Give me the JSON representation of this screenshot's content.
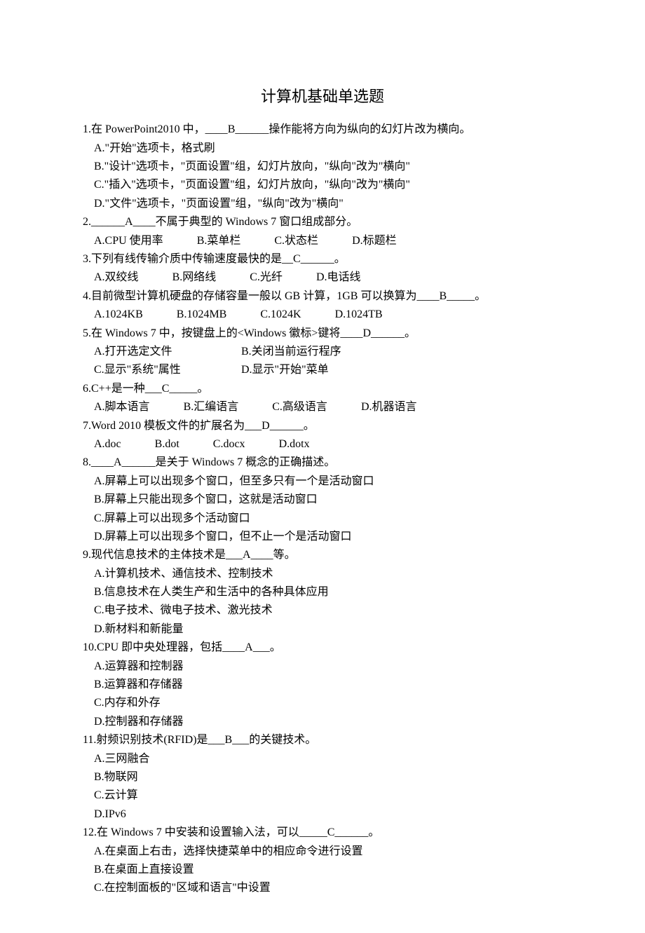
{
  "title": "计算机基础单选题",
  "questions": [
    {
      "num": "1",
      "stem_pre": "在 PowerPoint2010 中，____",
      "answer": "B",
      "stem_post": "______操作能将方向为纵向的幻灯片改为横向。",
      "options_layout": "block",
      "options": [
        "A.\"开始\"选项卡，格式刷",
        "B.\"设计\"选项卡，\"页面设置\"组，幻灯片放向，\"纵向\"改为\"横向\"",
        "C.\"插入\"选项卡，\"页面设置\"组，幻灯片放向，\"纵向\"改为\"横向\"",
        "D.\"文件\"选项卡，\"页面设置\"组，\"纵向\"改为\"横向\""
      ]
    },
    {
      "num": "2",
      "stem_pre": "______",
      "answer": "A",
      "stem_post": "____不属于典型的 Windows 7 窗口组成部分。",
      "options_layout": "inline",
      "options": [
        "A.CPU 使用率",
        "B.菜单栏",
        "C.状态栏",
        "D.标题栏"
      ]
    },
    {
      "num": "3",
      "stem_pre": "下列有线传输介质中传输速度最快的是__",
      "answer": "C",
      "stem_post": "______。",
      "options_layout": "inline",
      "options": [
        "A.双绞线",
        "B.网络线",
        "C.光纤",
        "D.电话线"
      ]
    },
    {
      "num": "4",
      "stem_pre": "目前微型计算机硬盘的存储容量一般以 GB 计算，1GB 可以换算为____",
      "answer": "B",
      "stem_post": "_____。",
      "options_layout": "inline",
      "options": [
        "A.1024KB",
        "B.1024MB",
        "C.1024K",
        "D.1024TB"
      ]
    },
    {
      "num": "5",
      "stem_pre": "在 Windows 7 中，按键盘上的<Windows 徽标>键将____",
      "answer": "D",
      "stem_post": "______。",
      "options_layout": "two-col",
      "options": [
        "A.打开选定文件",
        "B.关闭当前运行程序",
        "C.显示\"系统\"属性",
        "D.显示\"开始\"菜单"
      ]
    },
    {
      "num": "6",
      "stem_pre": "C++是一种___",
      "answer": "C",
      "stem_post": "_____。",
      "options_layout": "inline",
      "options": [
        "A.脚本语言",
        "B.汇编语言",
        "C.高级语言",
        "D.机器语言"
      ]
    },
    {
      "num": "7",
      "stem_pre": "Word 2010 模板文件的扩展名为___",
      "answer": "D",
      "stem_post": "______。",
      "options_layout": "inline",
      "options": [
        "A.doc",
        "B.dot",
        "C.docx",
        "D.dotx"
      ]
    },
    {
      "num": "8",
      "stem_pre": "____",
      "answer": "A",
      "stem_post": "______是关于 Windows 7 概念的正确描述。",
      "options_layout": "block",
      "options": [
        "A.屏幕上可以出现多个窗口，但至多只有一个是活动窗口",
        "B.屏幕上只能出现多个窗口，这就是活动窗口",
        "C.屏幕上可以出现多个活动窗口",
        "D.屏幕上可以出现多个窗口，但不止一个是活动窗口"
      ]
    },
    {
      "num": "9",
      "stem_pre": "现代信息技术的主体技术是___",
      "answer": "A",
      "stem_post": "____等。",
      "options_layout": "block",
      "options": [
        "A.计算机技术、通信技术、控制技术",
        "B.信息技术在人类生产和生活中的各种具体应用",
        "C.电子技术、微电子技术、激光技术",
        "D.新材料和新能量"
      ]
    },
    {
      "num": "10",
      "stem_pre": "CPU 即中央处理器，包括____",
      "answer": "A",
      "stem_post": "___。",
      "options_layout": "block",
      "options": [
        "A.运算器和控制器",
        "B.运算器和存储器",
        "C.内存和外存",
        "D.控制器和存储器"
      ]
    },
    {
      "num": "11",
      "stem_pre": "射频识别技术(RFID)是___",
      "answer": "B",
      "stem_post": "___的关键技术。",
      "options_layout": "block",
      "options": [
        "A.三网融合",
        "B.物联网",
        "C.云计算",
        "D.IPv6"
      ]
    },
    {
      "num": "12",
      "stem_pre": "在 Windows 7 中安装和设置输入法，可以_____",
      "answer": "C",
      "stem_post": "______。",
      "options_layout": "block",
      "options": [
        "A.在桌面上右击，选择快捷菜单中的相应命令进行设置",
        "B.在桌面上直接设置",
        "C.在控制面板的\"区域和语言\"中设置"
      ]
    }
  ]
}
